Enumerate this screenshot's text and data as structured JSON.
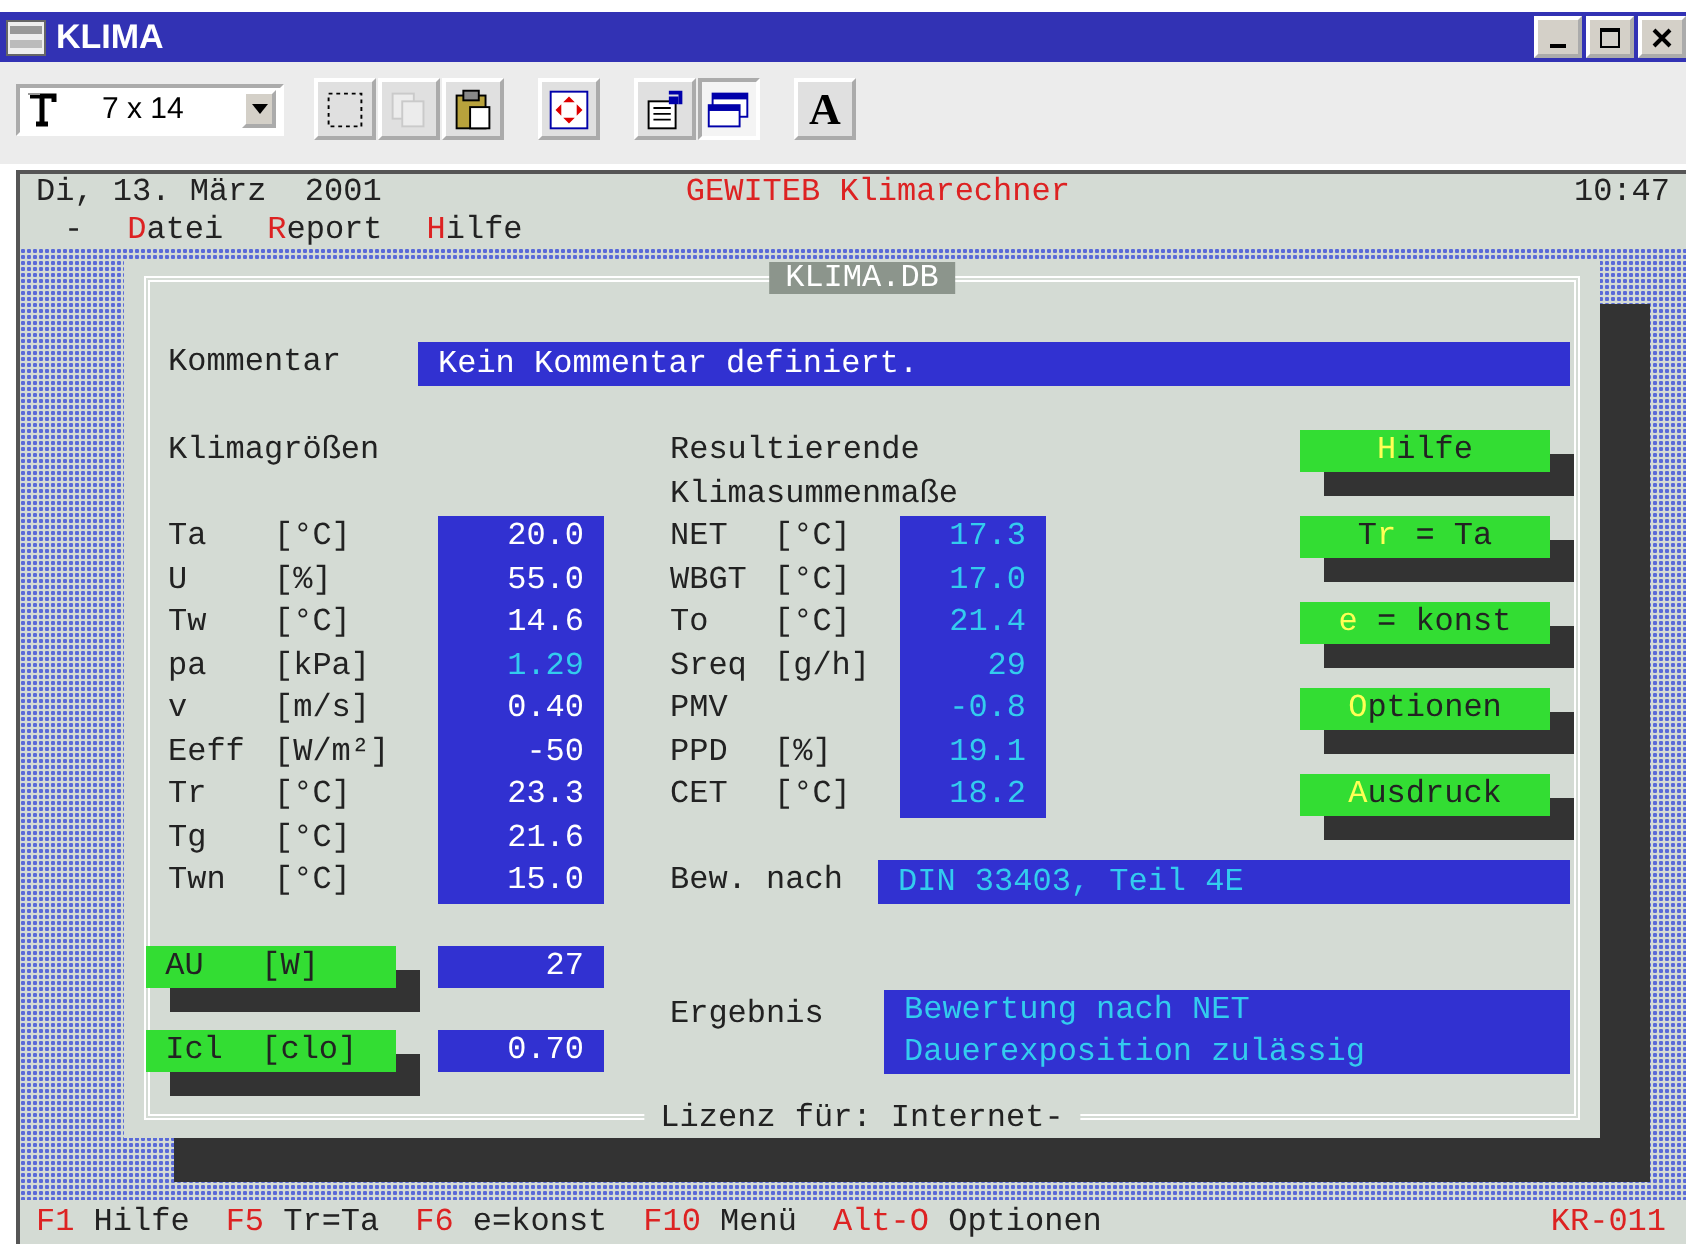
{
  "window": {
    "title": "KLIMA"
  },
  "toolbar": {
    "font_size": "7 x 14",
    "tools": [
      {
        "kind": "mark",
        "disabled": false,
        "pressed": false
      },
      {
        "kind": "copy",
        "disabled": true,
        "pressed": false
      },
      {
        "kind": "paste",
        "disabled": false,
        "pressed": false
      },
      {
        "kind": "fullscreen",
        "disabled": false,
        "pressed": false
      },
      {
        "kind": "properties",
        "disabled": false,
        "pressed": false
      },
      {
        "kind": "background",
        "disabled": false,
        "pressed": true
      },
      {
        "kind": "font",
        "glyph": "A",
        "disabled": false,
        "pressed": false
      }
    ]
  },
  "header": {
    "date": "Di, 13. März  2001",
    "title": "GEWITEB Klimarechner",
    "time": "10:47"
  },
  "menu": {
    "system": "-",
    "items": [
      {
        "key": "D",
        "rest": "atei"
      },
      {
        "key": "R",
        "rest": "eport"
      },
      {
        "key": "H",
        "rest": "ilfe"
      }
    ]
  },
  "dialog": {
    "title": "KLIMA.DB",
    "footer": "Lizenz für: Internet-",
    "comment": {
      "label": "Kommentar",
      "value": "Kein Kommentar definiert."
    },
    "inputs": {
      "heading": "Klimagrößen",
      "rows": [
        {
          "name": "Ta",
          "unit": "[°C]",
          "value": "20.0",
          "kind": "input"
        },
        {
          "name": "U",
          "unit": "[%]",
          "value": "55.0",
          "kind": "input"
        },
        {
          "name": "Tw",
          "unit": "[°C]",
          "value": "14.6",
          "kind": "input"
        },
        {
          "name": "pa",
          "unit": "[kPa]",
          "value": "1.29",
          "kind": "computed"
        },
        {
          "name": "v",
          "unit": "[m/s]",
          "value": "0.40",
          "kind": "input"
        },
        {
          "name": "Eeff",
          "unit": "[W/m²]",
          "value": "-50",
          "kind": "input"
        },
        {
          "name": "Tr",
          "unit": "[°C]",
          "value": "23.3",
          "kind": "input"
        },
        {
          "name": "Tg",
          "unit": "[°C]",
          "value": "21.6",
          "kind": "input"
        },
        {
          "name": "Twn",
          "unit": "[°C]",
          "value": "15.0",
          "kind": "input"
        }
      ]
    },
    "params": [
      {
        "name": "AU",
        "unit": "[W]",
        "value": "27"
      },
      {
        "name": "Icl",
        "unit": "[clo]",
        "value": "0.70"
      }
    ],
    "results": {
      "heading": "Resultierende Klimasummenmaße",
      "rows": [
        {
          "name": "NET",
          "unit": "[°C]",
          "value": "17.3",
          "kind": "computed"
        },
        {
          "name": "WBGT",
          "unit": "[°C]",
          "value": "17.0",
          "kind": "computed"
        },
        {
          "name": "To",
          "unit": "[°C]",
          "value": "21.4",
          "kind": "computed"
        },
        {
          "name": "Sreq",
          "unit": "[g/h]",
          "value": "29",
          "kind": "computed"
        },
        {
          "name": "PMV",
          "value": "-0.8",
          "kind": "computed"
        },
        {
          "name": "PPD",
          "unit": "[%]",
          "value": "19.1",
          "kind": "computed"
        },
        {
          "name": "CET",
          "unit": "[°C]",
          "value": "18.2",
          "kind": "computed"
        }
      ]
    },
    "buttons": [
      {
        "key": "H",
        "after": "ilfe"
      },
      {
        "before": "T",
        "key": "r",
        "after": " = Ta"
      },
      {
        "key": "e",
        "after": " = konst"
      },
      {
        "key": "O",
        "after": "ptionen"
      },
      {
        "key": "A",
        "after": "usdruck"
      }
    ],
    "assessment": {
      "label": "Bew. nach",
      "value": "DIN 33403, Teil 4E"
    },
    "result": {
      "label": "Ergebnis",
      "lines": [
        "Bewertung nach NET",
        "Dauerexposition zulässig"
      ]
    }
  },
  "status_bar": {
    "items": [
      {
        "key": "F1",
        "label": "Hilfe"
      },
      {
        "key": "F5",
        "label": "Tr=Ta"
      },
      {
        "key": "F6",
        "label": "e=konst"
      },
      {
        "key": "F10",
        "label": "Menü"
      },
      {
        "key": "Alt-O",
        "label": "Optionen"
      }
    ],
    "code": "KR-011"
  }
}
